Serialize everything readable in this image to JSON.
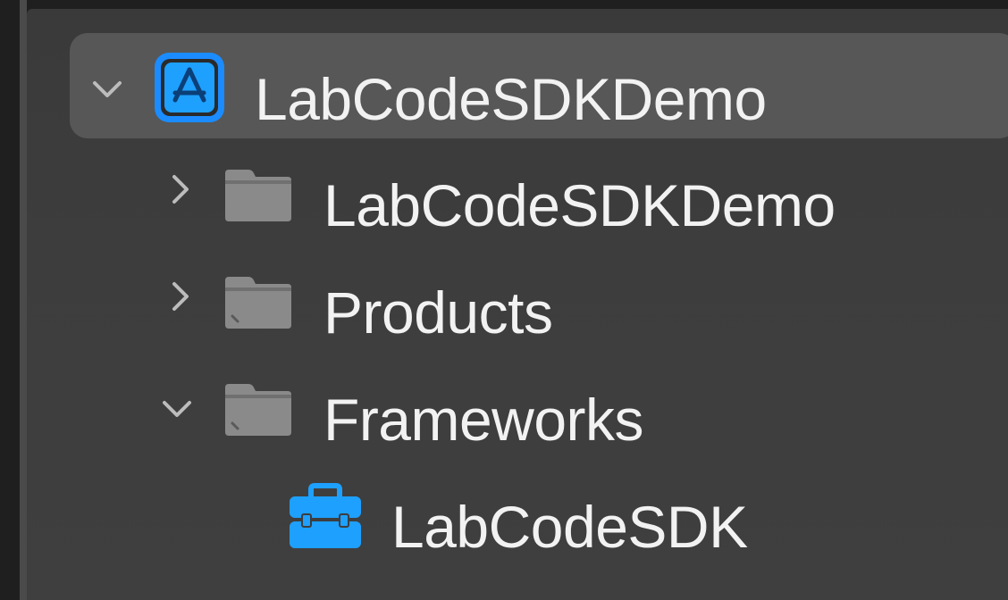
{
  "project_navigator": {
    "items": [
      {
        "label": "LabCodeSDKDemo",
        "icon": "app-project-icon",
        "disclosure": "expanded",
        "level": 0,
        "selected": true
      },
      {
        "label": "LabCodeSDKDemo",
        "icon": "folder-icon",
        "disclosure": "collapsed",
        "level": 1,
        "selected": false
      },
      {
        "label": "Products",
        "icon": "folder-icon",
        "disclosure": "collapsed",
        "level": 1,
        "selected": false
      },
      {
        "label": "Frameworks",
        "icon": "folder-icon",
        "disclosure": "expanded",
        "level": 1,
        "selected": false
      },
      {
        "label": "LabCodeSDK",
        "icon": "toolbox-icon",
        "disclosure": "none",
        "level": 2,
        "selected": false
      }
    ]
  },
  "colors": {
    "background": "#1f1f1f",
    "navigator_background": "#3d3d3d",
    "selection": "#575757",
    "text": "#f2f2f2",
    "folder": "#8a8a8a",
    "accent_blue": "#1ea0ff"
  }
}
